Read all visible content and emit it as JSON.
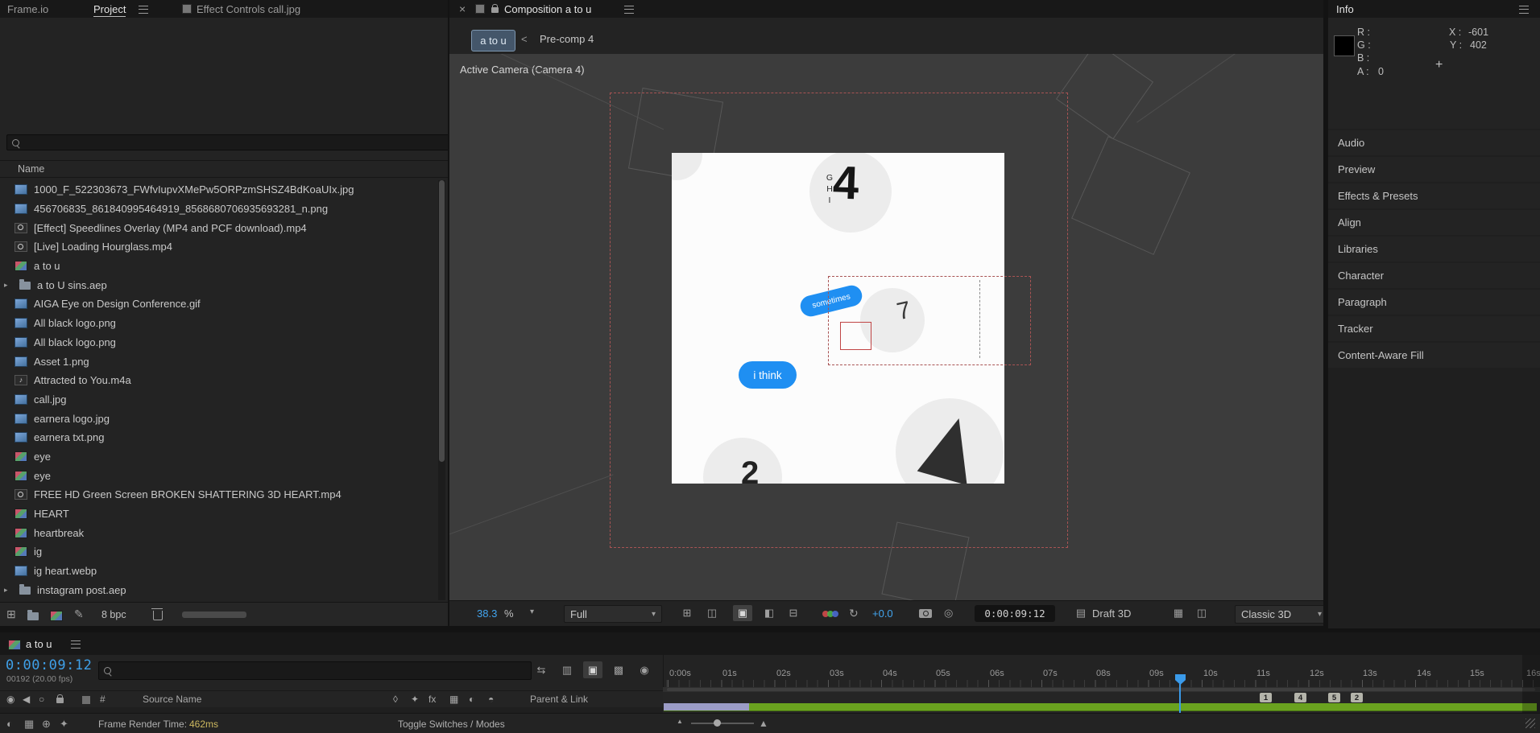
{
  "left_tabs": {
    "frameio": "Frame.io",
    "project": "Project",
    "effect_controls": "Effect Controls call.jpg"
  },
  "project_panel": {
    "name_header": "Name",
    "bpc_label": "8 bpc",
    "items": [
      {
        "label": "1000_F_522303673_FWfvIupvXMePw5ORPzmSHSZ4BdKoaUIx.jpg",
        "type": "footage"
      },
      {
        "label": "456706835_861840995464919_8568680706935693281_n.png",
        "type": "footage"
      },
      {
        "label": "[Effect] Speedlines Overlay (MP4 and PCF download).mp4",
        "type": "video"
      },
      {
        "label": "[Live] Loading Hourglass.mp4",
        "type": "video"
      },
      {
        "label": "a to u",
        "type": "comp"
      },
      {
        "label": "a to U sins.aep",
        "type": "folder"
      },
      {
        "label": "AIGA Eye on Design Conference.gif",
        "type": "footage"
      },
      {
        "label": "All black logo.png",
        "type": "footage"
      },
      {
        "label": "All black logo.png",
        "type": "footage"
      },
      {
        "label": "Asset 1.png",
        "type": "footage"
      },
      {
        "label": "Attracted to You.m4a",
        "type": "audio"
      },
      {
        "label": "call.jpg",
        "type": "footage"
      },
      {
        "label": "earnera logo.jpg",
        "type": "footage"
      },
      {
        "label": "earnera txt.png",
        "type": "footage"
      },
      {
        "label": "eye",
        "type": "comp"
      },
      {
        "label": "eye",
        "type": "comp"
      },
      {
        "label": "FREE HD Green Screen BROKEN SHATTERING 3D HEART.mp4",
        "type": "video"
      },
      {
        "label": "HEART",
        "type": "comp"
      },
      {
        "label": "heartbreak",
        "type": "comp"
      },
      {
        "label": "ig",
        "type": "comp"
      },
      {
        "label": "ig heart.webp",
        "type": "footage"
      },
      {
        "label": "instagram post.aep",
        "type": "folder"
      }
    ]
  },
  "composition_panel": {
    "tab_label": "Composition a to u",
    "breadcrumb_current": "a to u",
    "breadcrumb_separator": "<",
    "breadcrumb_parent": "Pre-comp 4",
    "view_label": "Active Camera (Camera 4)",
    "canvas": {
      "big_numeral": "4",
      "vertical_letters": "GHI",
      "numeral_seven": "7",
      "numeral_two": "2",
      "bubble_sometimes": "sometimes",
      "bubble_i_think": "i think"
    },
    "toolbar": {
      "zoom_value": "38.3",
      "zoom_unit": "%",
      "resolution": "Full",
      "exposure": "+0.0",
      "timecode": "0:00:09:12",
      "renderer": "Draft 3D",
      "view_mode": "Classic 3D"
    }
  },
  "info_panel": {
    "tab_label": "Info",
    "r_label": "R :",
    "g_label": "G :",
    "b_label": "B :",
    "a_label": "A :",
    "a_value": "0",
    "x_label": "X :",
    "x_value": "-601",
    "y_label": "Y :",
    "y_value": "402",
    "crosshair": "+"
  },
  "side_panels": [
    {
      "label": "Audio"
    },
    {
      "label": "Preview"
    },
    {
      "label": "Effects & Presets"
    },
    {
      "label": "Align"
    },
    {
      "label": "Libraries"
    },
    {
      "label": "Character"
    },
    {
      "label": "Paragraph"
    },
    {
      "label": "Tracker"
    },
    {
      "label": "Content-Aware Fill"
    }
  ],
  "timeline": {
    "tab_label": "a to u",
    "timecode": "0:00:09:12",
    "frame_info": "00192 (20.00 fps)",
    "columns": {
      "hash": "#",
      "source_name": "Source Name",
      "parent_link": "Parent & Link"
    },
    "ruler_labels": [
      "0:00s",
      "01s",
      "02s",
      "03s",
      "04s",
      "05s",
      "06s",
      "07s",
      "08s",
      "09s",
      "10s",
      "11s",
      "12s",
      "13s",
      "14s",
      "15s",
      "16s"
    ],
    "markers": [
      {
        "num": "1"
      },
      {
        "num": "4"
      },
      {
        "num": "5"
      },
      {
        "num": "2"
      }
    ],
    "status": {
      "render_time_label": "Frame Render Time:",
      "render_time_value": "462ms",
      "toggle_label": "Toggle Switches / Modes"
    }
  }
}
